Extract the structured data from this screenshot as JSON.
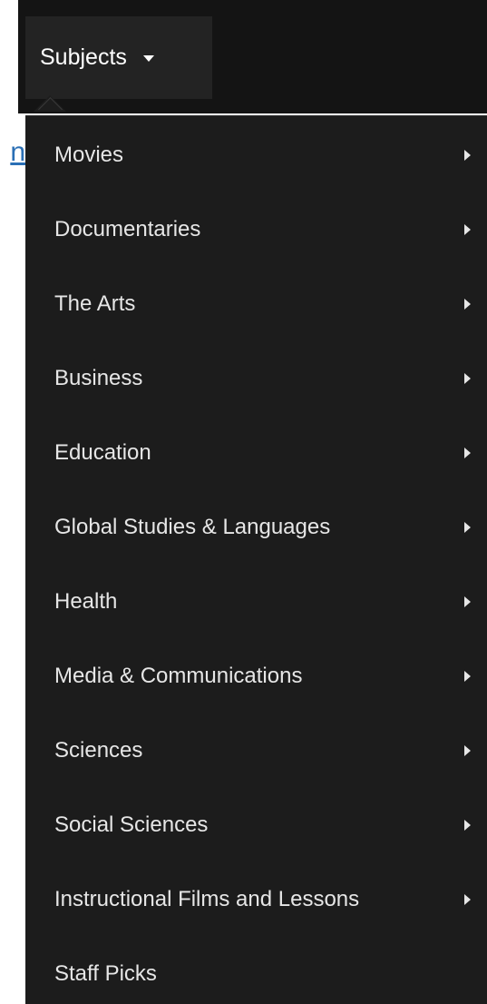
{
  "nav": {
    "subjects_label": "Subjects",
    "link_fragment": "n"
  },
  "colors": {
    "background": "#141414",
    "menu_background": "#1c1c1c",
    "tab_background": "#232323",
    "text": "#e6e6e6",
    "link": "#2a6fb5"
  },
  "menu": {
    "items": [
      {
        "label": "Movies",
        "has_submenu": true
      },
      {
        "label": "Documentaries",
        "has_submenu": true
      },
      {
        "label": "The Arts",
        "has_submenu": true
      },
      {
        "label": "Business",
        "has_submenu": true
      },
      {
        "label": "Education",
        "has_submenu": true
      },
      {
        "label": "Global Studies & Languages",
        "has_submenu": true
      },
      {
        "label": "Health",
        "has_submenu": true
      },
      {
        "label": "Media & Communications",
        "has_submenu": true
      },
      {
        "label": "Sciences",
        "has_submenu": true
      },
      {
        "label": "Social Sciences",
        "has_submenu": true
      },
      {
        "label": "Instructional Films and Lessons",
        "has_submenu": true
      },
      {
        "label": "Staff Picks",
        "has_submenu": false
      }
    ]
  }
}
